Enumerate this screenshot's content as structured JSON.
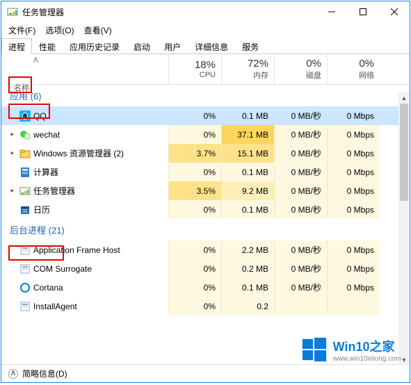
{
  "window": {
    "title": "任务管理器",
    "menu": {
      "file": "文件(F)",
      "options": "选项(O)",
      "view": "查看(V)"
    },
    "controls": {
      "min": "minimize",
      "max": "maximize",
      "close": "close"
    }
  },
  "tabs": [
    "进程",
    "性能",
    "应用历史记录",
    "启动",
    "用户",
    "详细信息",
    "服务"
  ],
  "active_tab": 0,
  "columns": {
    "name": "名称",
    "stats": [
      {
        "pct": "18%",
        "label": "CPU"
      },
      {
        "pct": "72%",
        "label": "内存"
      },
      {
        "pct": "0%",
        "label": "磁盘"
      },
      {
        "pct": "0%",
        "label": "网络"
      }
    ]
  },
  "groups": [
    {
      "name": "应用",
      "count": "(6)"
    },
    {
      "name": "后台进程",
      "count": "(21)"
    }
  ],
  "apps": [
    {
      "expand": "",
      "icon": "qq",
      "name": "QQ",
      "selected": true,
      "vals": [
        "0%",
        "0.1 MB",
        "0 MB/秒",
        "0 Mbps"
      ],
      "heat": [
        0,
        0,
        0,
        0
      ]
    },
    {
      "expand": "▸",
      "icon": "wechat",
      "name": "wechat",
      "vals": [
        "0%",
        "37.1 MB",
        "0 MB/秒",
        "0 Mbps"
      ],
      "heat": [
        0,
        3,
        0,
        0
      ]
    },
    {
      "expand": "▸",
      "icon": "explorer",
      "name": "Windows 资源管理器 (2)",
      "vals": [
        "3.7%",
        "15.1 MB",
        "0 MB/秒",
        "0 Mbps"
      ],
      "heat": [
        2,
        2,
        0,
        0
      ]
    },
    {
      "expand": "",
      "icon": "calc",
      "name": "计算器",
      "vals": [
        "0%",
        "0.1 MB",
        "0 MB/秒",
        "0 Mbps"
      ],
      "heat": [
        0,
        0,
        0,
        0
      ]
    },
    {
      "expand": "▸",
      "icon": "taskmgr",
      "name": "任务管理器",
      "vals": [
        "3.5%",
        "9.2 MB",
        "0 MB/秒",
        "0 Mbps"
      ],
      "heat": [
        2,
        1,
        0,
        0
      ]
    },
    {
      "expand": "",
      "icon": "calendar",
      "name": "日历",
      "vals": [
        "0%",
        "0.1 MB",
        "0 MB/秒",
        "0 Mbps"
      ],
      "heat": [
        0,
        0,
        0,
        0
      ]
    }
  ],
  "bg": [
    {
      "icon": "generic",
      "name": "Application Frame Host",
      "vals": [
        "0%",
        "2.2 MB",
        "0 MB/秒",
        "0 Mbps"
      ],
      "heat": [
        0,
        0,
        0,
        0
      ]
    },
    {
      "icon": "generic",
      "name": "COM Surrogate",
      "vals": [
        "0%",
        "0.2 MB",
        "0 MB/秒",
        "0 Mbps"
      ],
      "heat": [
        0,
        0,
        0,
        0
      ]
    },
    {
      "icon": "cortana",
      "name": "Cortana",
      "vals": [
        "0%",
        "0.1 MB",
        "0 MB/秒",
        "0 Mbps"
      ],
      "heat": [
        0,
        0,
        0,
        0
      ]
    },
    {
      "icon": "generic",
      "name": "InstallAgent",
      "vals": [
        "0%",
        "0.2",
        "",
        ""
      ],
      "heat": [
        0,
        0,
        0,
        0
      ]
    }
  ],
  "status": {
    "less": "简略信息(D)"
  },
  "watermark": {
    "brand": "Win10之家",
    "url": "www.win10xitong.com"
  }
}
